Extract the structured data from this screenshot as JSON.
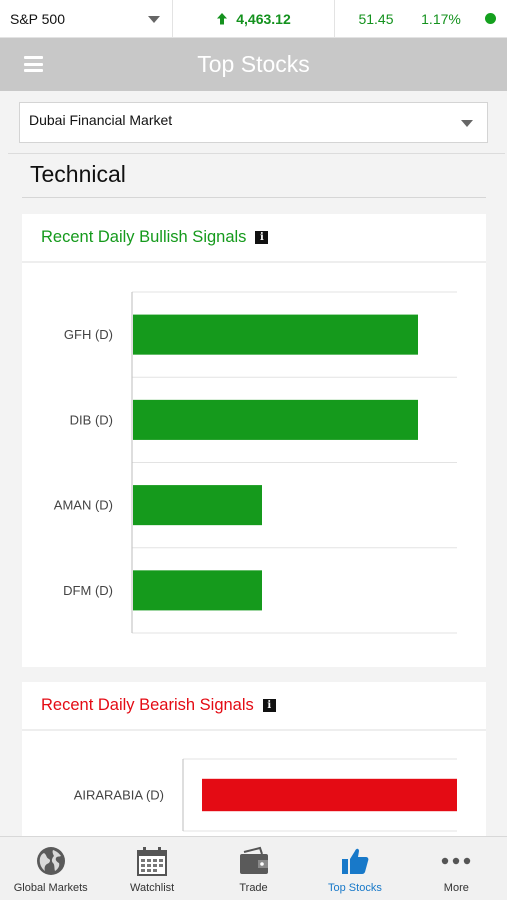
{
  "ticker": {
    "index_label": "S&P 500",
    "value": "4,463.12",
    "change": "51.45",
    "percent": "1.17%",
    "status_color": "#14a01e",
    "direction_icon": "arrow-up-icon"
  },
  "header": {
    "title": "Top Stocks",
    "menu_icon": "hamburger-menu-icon"
  },
  "market_select": {
    "selected": "Dubai Financial Market"
  },
  "section": {
    "title": "Technical"
  },
  "bullish": {
    "title": "Recent Daily Bullish Signals",
    "color": "#159a1c",
    "chart_data": {
      "type": "bar",
      "orientation": "horizontal",
      "categories": [
        "GFH (D)",
        "DIB (D)",
        "AMAN (D)",
        "DFM (D)"
      ],
      "values": [
        2.2,
        2.2,
        1.0,
        1.0
      ],
      "xlim": [
        0,
        2.5
      ],
      "grid": true
    }
  },
  "bearish": {
    "title": "Recent Daily Bearish Signals",
    "color": "#e40b14",
    "chart_data": {
      "type": "bar",
      "orientation": "horizontal",
      "categories": [
        "AIRARABIA (D)"
      ],
      "values": [
        1.0
      ],
      "xlim": [
        0,
        1.0
      ],
      "grid": true
    }
  },
  "nav": {
    "items": [
      {
        "label": "Global Markets",
        "icon": "globe-icon",
        "active": false
      },
      {
        "label": "Watchlist",
        "icon": "calendar-grid-icon",
        "active": false
      },
      {
        "label": "Trade",
        "icon": "wallet-icon",
        "active": false
      },
      {
        "label": "Top Stocks",
        "icon": "thumbs-up-icon",
        "active": true
      },
      {
        "label": "More",
        "icon": "more-dots-icon",
        "active": false
      }
    ],
    "active_color": "#1879c9"
  }
}
